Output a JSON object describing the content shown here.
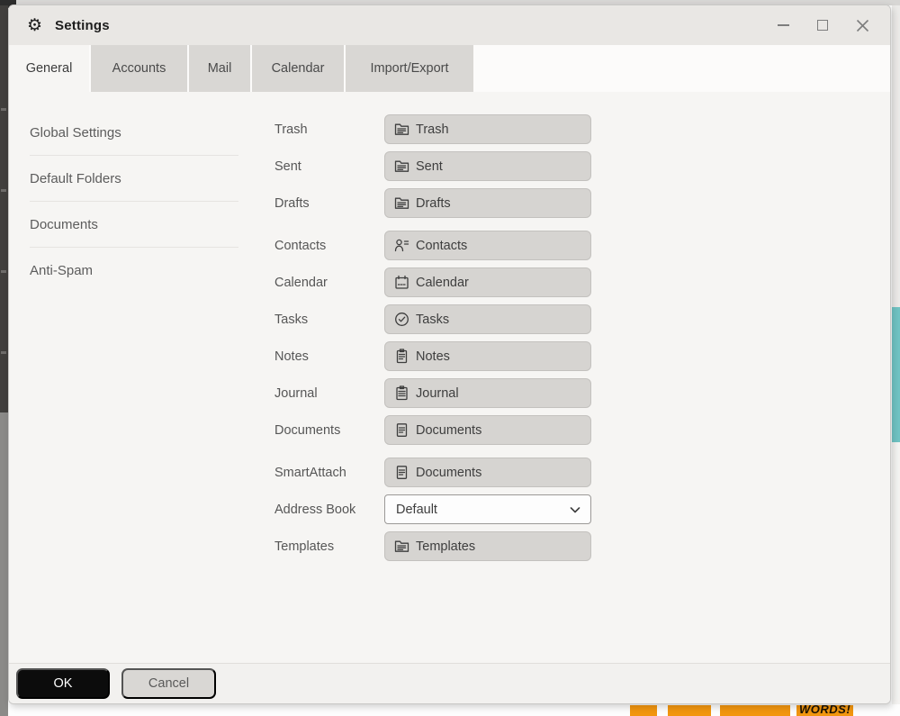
{
  "window": {
    "title": "Settings",
    "gear_glyph": "⚙"
  },
  "tabs": [
    {
      "label": "General",
      "active": true
    },
    {
      "label": "Accounts",
      "active": false
    },
    {
      "label": "Mail",
      "active": false
    },
    {
      "label": "Calendar",
      "active": false
    },
    {
      "label": "Import/Export",
      "active": false
    }
  ],
  "sidebar": {
    "items": [
      {
        "label": "Global Settings"
      },
      {
        "label": "Default Folders"
      },
      {
        "label": "Documents"
      },
      {
        "label": "Anti-Spam"
      }
    ]
  },
  "content": {
    "rows": [
      {
        "label": "Trash",
        "value": "Trash",
        "control": "button",
        "icon": "mail-folder-icon"
      },
      {
        "label": "Sent",
        "value": "Sent",
        "control": "button",
        "icon": "mail-folder-icon"
      },
      {
        "label": "Drafts",
        "value": "Drafts",
        "control": "button",
        "icon": "mail-folder-icon"
      },
      {
        "label": "Contacts",
        "value": "Contacts",
        "control": "button",
        "icon": "contacts-icon"
      },
      {
        "label": "Calendar",
        "value": "Calendar",
        "control": "button",
        "icon": "calendar-icon"
      },
      {
        "label": "Tasks",
        "value": "Tasks",
        "control": "button",
        "icon": "tasks-icon"
      },
      {
        "label": "Notes",
        "value": "Notes",
        "control": "button",
        "icon": "notes-icon"
      },
      {
        "label": "Journal",
        "value": "Journal",
        "control": "button",
        "icon": "journal-icon"
      },
      {
        "label": "Documents",
        "value": "Documents",
        "control": "button",
        "icon": "document-icon"
      },
      {
        "label": "SmartAttach",
        "value": "Documents",
        "control": "button",
        "icon": "document-icon"
      },
      {
        "label": "Address Book",
        "value": "Default",
        "control": "select",
        "icon": "chevron-down-icon"
      },
      {
        "label": "Templates",
        "value": "Templates",
        "control": "button",
        "icon": "mail-folder-icon"
      }
    ]
  },
  "footer": {
    "ok_label": "OK",
    "cancel_label": "Cancel"
  },
  "background": {
    "banner_text": "WORDS!"
  },
  "colors": {
    "titlebar": "#e9e7e4",
    "inactive_tab": "#d9d7d4",
    "content_bg": "#f6f5f3",
    "button_bg": "#d6d4d1",
    "ok_button": "#0c0c0c",
    "teal_strip": "#70c3c3",
    "banner_orange": "#f2960f"
  }
}
